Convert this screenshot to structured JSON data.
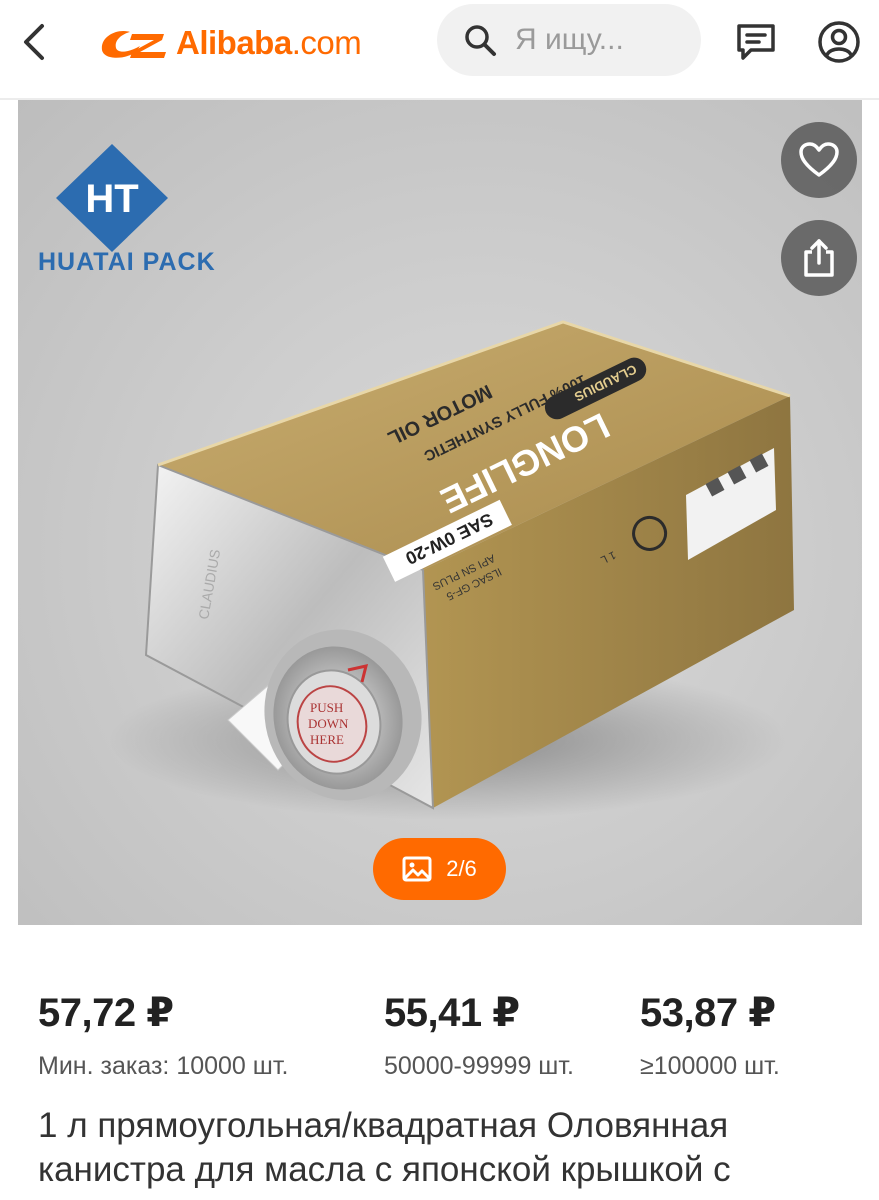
{
  "header": {
    "logo_brand": "Alibaba",
    "logo_domain": ".com",
    "search_placeholder": "Я ищу...",
    "icons": [
      "back-arrow-icon",
      "search-icon",
      "message-icon",
      "account-icon"
    ]
  },
  "gallery": {
    "counter": "2/6",
    "watermark_text": "HUATAI PACK",
    "watermark_logo": "HT",
    "can_labels": {
      "brand": "LONGLIFE",
      "line1": "100% FULLY SYNTHETIC",
      "line2": "MOTOR OIL",
      "grade": "SAE 0W-20",
      "spec1": "API SN PLUS",
      "spec2": "ILSAC GF-5",
      "maker": "CLAUDIUS",
      "volume": "1 L",
      "cap1": "PUSH",
      "cap2": "DOWN",
      "cap3": "HERE"
    },
    "icons": [
      "heart-icon",
      "share-icon",
      "image-icon"
    ]
  },
  "prices": [
    {
      "price": "57,72 ₽",
      "qty": "Мин. заказ: 10000 шт."
    },
    {
      "price": "55,41 ₽",
      "qty": "50000-99999 шт."
    },
    {
      "price": "53,87 ₽",
      "qty": "≥100000 шт."
    }
  ],
  "title": "1 л прямоугольная/квадратная Оловянная канистра для масла с японской крышкой с",
  "colors": {
    "accent": "#ff6a00",
    "watermark_blue": "#2c6cb0",
    "can_gold": "#b89a5c"
  }
}
